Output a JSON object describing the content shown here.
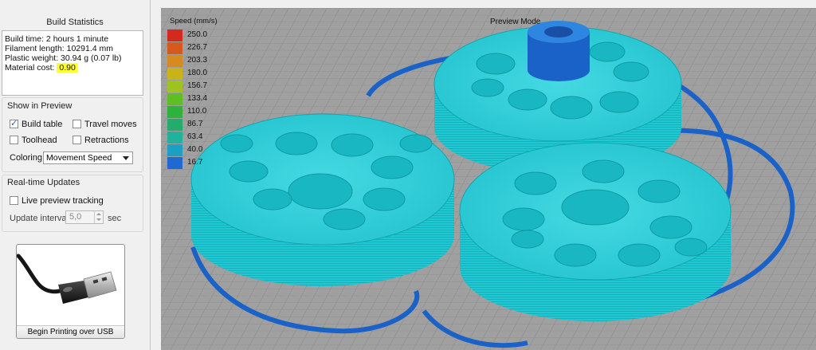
{
  "build_statistics": {
    "title": "Build Statistics",
    "build_time": "Build time: 2 hours 1 minute",
    "filament_length": "Filament length: 10291.4 mm",
    "plastic_weight": "Plastic weight: 30.94 g (0.07 lb)",
    "material_cost_label": "Material cost:",
    "material_cost_value": "0.90"
  },
  "show_in_preview": {
    "title": "Show in Preview",
    "build_table": {
      "label": "Build table",
      "checked": true
    },
    "travel_moves": {
      "label": "Travel moves",
      "checked": false
    },
    "toolhead": {
      "label": "Toolhead",
      "checked": false
    },
    "retractions": {
      "label": "Retractions",
      "checked": false
    },
    "coloring_label": "Coloring",
    "coloring_value": "Movement Speed"
  },
  "realtime_updates": {
    "title": "Real-time Updates",
    "live_preview": {
      "label": "Live preview tracking",
      "checked": false
    },
    "update_interval_label": "Update interval",
    "update_interval_value": "5,0",
    "update_interval_unit": "sec"
  },
  "usb_button": {
    "label": "Begin Printing over USB"
  },
  "viewport": {
    "mode_label": "Preview Mode",
    "legend_title": "Speed (mm/s)",
    "legend": [
      {
        "value": "250.0",
        "color": "#d42a1e"
      },
      {
        "value": "226.7",
        "color": "#d65a1c"
      },
      {
        "value": "203.3",
        "color": "#d88a1e"
      },
      {
        "value": "180.0",
        "color": "#c8b418"
      },
      {
        "value": "156.7",
        "color": "#9ec21e"
      },
      {
        "value": "133.4",
        "color": "#5fbf22"
      },
      {
        "value": "110.0",
        "color": "#2eb33a"
      },
      {
        "value": "86.7",
        "color": "#22ad6c"
      },
      {
        "value": "63.4",
        "color": "#20b29a"
      },
      {
        "value": "40.0",
        "color": "#1c9fc4"
      },
      {
        "value": "16.7",
        "color": "#1e6ad2"
      }
    ],
    "part_color": "#1fc9d3",
    "travel_color": "#1a62c8"
  }
}
